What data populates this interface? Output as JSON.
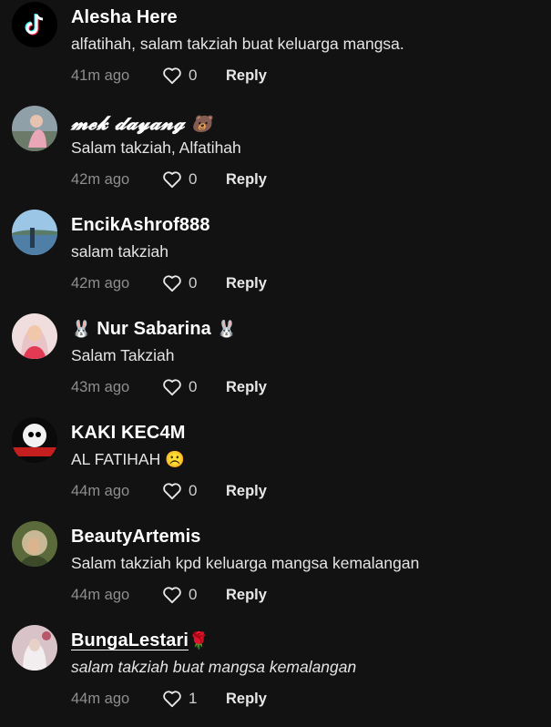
{
  "comments": [
    {
      "username": "Alesha Here",
      "emoji": "",
      "text": "alfatihah, salam takziah buat keluarga mangsa.",
      "time": "41m ago",
      "likes": "0",
      "reply": "Reply"
    },
    {
      "username": "𝓶𝓮𝓴 𝓭𝓪𝔂𝓪𝓷𝓰",
      "emoji": "🐻",
      "text": "Salam takziah, Alfatihah",
      "time": "42m ago",
      "likes": "0",
      "reply": "Reply"
    },
    {
      "username": "EncikAshrof888",
      "emoji": "",
      "text": "salam takziah",
      "time": "42m ago",
      "likes": "0",
      "reply": "Reply"
    },
    {
      "username": "Nur Sabarina",
      "emoji_left": "🐰",
      "emoji": "🐰",
      "text": "Salam Takziah",
      "time": "43m ago",
      "likes": "0",
      "reply": "Reply"
    },
    {
      "username": "KAKI KEC4M",
      "emoji": "",
      "text": "AL FATIHAH",
      "text_emoji": "☹️",
      "time": "44m ago",
      "likes": "0",
      "reply": "Reply"
    },
    {
      "username": "BeautyArtemis",
      "emoji": "",
      "text": "Salam takziah kpd keluarga mangsa kemalangan",
      "time": "44m ago",
      "likes": "0",
      "reply": "Reply"
    },
    {
      "username": "BungaLestari",
      "emoji": "🌹",
      "text": "salam takziah buat mangsa kemalangan",
      "time": "44m ago",
      "likes": "1",
      "reply": "Reply"
    }
  ],
  "icons": {
    "like": "heart-outline-icon",
    "tiktok": "tiktok-logo-icon"
  },
  "colors": {
    "background": "#121212",
    "secondary_text": "#8e8e8e"
  }
}
